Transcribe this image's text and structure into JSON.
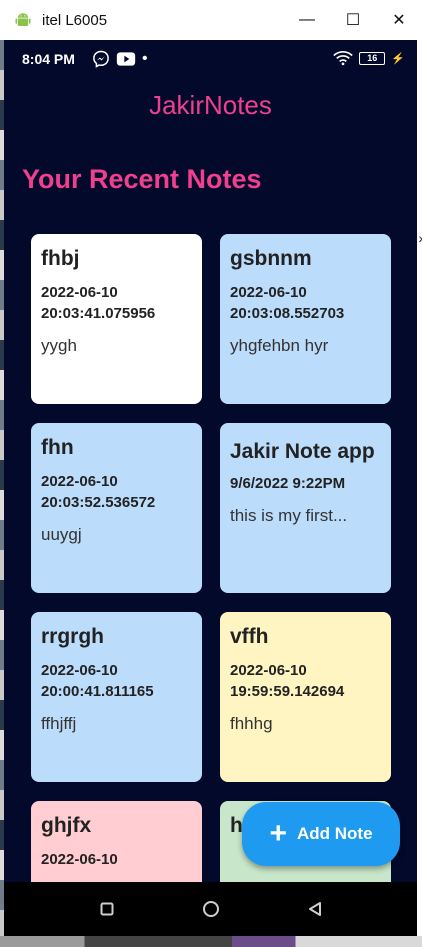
{
  "window": {
    "title": "itel L6005",
    "controls": {
      "minimize": "—",
      "maximize": "☐",
      "close": "✕"
    }
  },
  "statusbar": {
    "time": "8:04 PM",
    "battery": "16"
  },
  "app": {
    "title": "JakirNotes",
    "section_title": "Your Recent Notes"
  },
  "notes": [
    {
      "title": "fhbj",
      "date": "2022-06-10 20:03:41.075956",
      "body": "yygh",
      "color": "#ffffff"
    },
    {
      "title": "gsbnnm",
      "date": "2022-06-10 20:03:08.552703",
      "body": "yhgfehbn hyr",
      "color": "#bcdcfc"
    },
    {
      "title": "fhn",
      "date": "2022-06-10 20:03:52.536572",
      "body": "uuygj",
      "color": "#bcdcfc"
    },
    {
      "title": "Jakir Note app",
      "date": "9/6/2022 9:22PM",
      "body": "this is my first...",
      "color": "#bcdcfc"
    },
    {
      "title": "rrgrgh",
      "date": "2022-06-10 20:00:41.811165",
      "body": "ffhjffj",
      "color": "#bcdcfc"
    },
    {
      "title": "vffh",
      "date": "2022-06-10 19:59:59.142694",
      "body": "fhhhg",
      "color": "#fff5c2"
    },
    {
      "title": "ghjfx",
      "date": "2022-06-10",
      "body": "",
      "color": "#ffcdd2"
    },
    {
      "title": "h",
      "date": "",
      "body": "",
      "color": "#c8e6c9"
    }
  ],
  "fab": {
    "label": "Add Note",
    "icon": "plus-icon"
  },
  "navbar": {
    "icons": [
      "recents-square-icon",
      "home-circle-icon",
      "back-triangle-icon"
    ]
  }
}
